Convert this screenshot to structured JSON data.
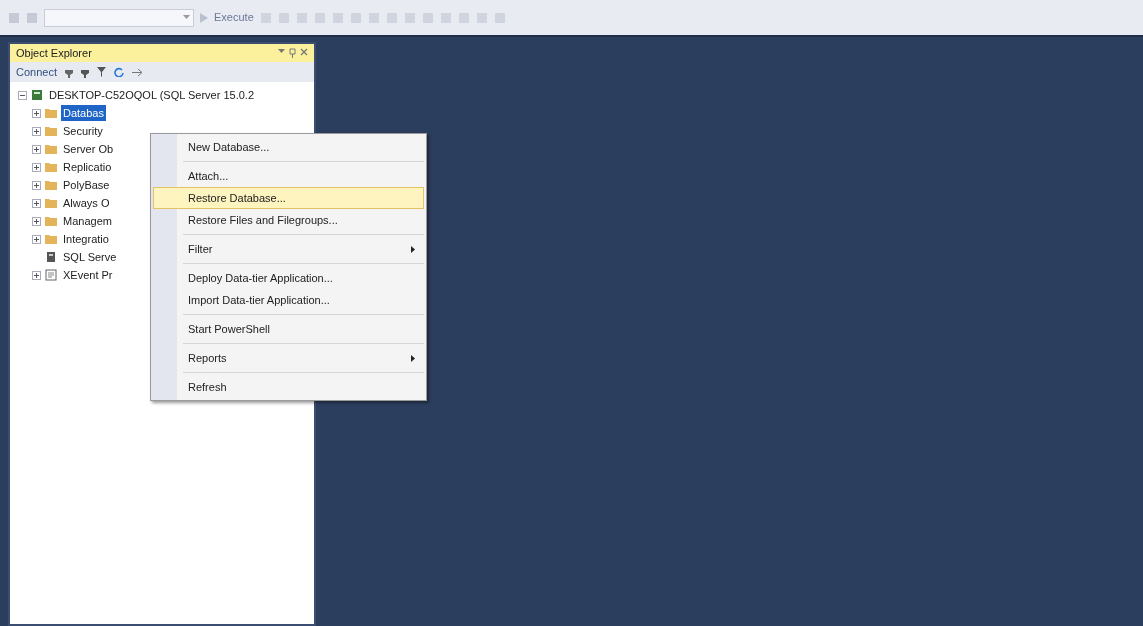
{
  "toolbar": {
    "execute_label": "Execute"
  },
  "object_explorer": {
    "title": "Object Explorer",
    "connect_label": "Connect",
    "tree": [
      {
        "label": "DESKTOP-C52OQOL (SQL Server 15.0.2",
        "kind": "server",
        "expanded": true,
        "selected": false,
        "children": [
          {
            "label": "Databas",
            "kind": "folder",
            "expanded": false,
            "selected": true
          },
          {
            "label": "Security",
            "kind": "folder",
            "expanded": false,
            "selected": false
          },
          {
            "label": "Server Ob",
            "kind": "folder",
            "expanded": false,
            "selected": false
          },
          {
            "label": "Replicatio",
            "kind": "folder",
            "expanded": false,
            "selected": false
          },
          {
            "label": "PolyBase",
            "kind": "folder",
            "expanded": false,
            "selected": false
          },
          {
            "label": "Always O",
            "kind": "folder",
            "expanded": false,
            "selected": false
          },
          {
            "label": "Managem",
            "kind": "folder",
            "expanded": false,
            "selected": false
          },
          {
            "label": "Integratio",
            "kind": "folder",
            "expanded": false,
            "selected": false
          },
          {
            "label": "SQL Serve",
            "kind": "agent",
            "selected": false
          },
          {
            "label": "XEvent Pr",
            "kind": "profiler",
            "expanded": false,
            "selected": false
          }
        ]
      }
    ]
  },
  "context_menu": [
    {
      "kind": "item",
      "label": "New Database...",
      "selected": false,
      "submenu": false
    },
    {
      "kind": "separator"
    },
    {
      "kind": "item",
      "label": "Attach...",
      "selected": false,
      "submenu": false
    },
    {
      "kind": "item",
      "label": "Restore Database...",
      "selected": true,
      "submenu": false
    },
    {
      "kind": "item",
      "label": "Restore Files and Filegroups...",
      "selected": false,
      "submenu": false
    },
    {
      "kind": "separator"
    },
    {
      "kind": "item",
      "label": "Filter",
      "selected": false,
      "submenu": true
    },
    {
      "kind": "separator"
    },
    {
      "kind": "item",
      "label": "Deploy Data-tier Application...",
      "selected": false,
      "submenu": false
    },
    {
      "kind": "item",
      "label": "Import Data-tier Application...",
      "selected": false,
      "submenu": false
    },
    {
      "kind": "separator"
    },
    {
      "kind": "item",
      "label": "Start PowerShell",
      "selected": false,
      "submenu": false
    },
    {
      "kind": "separator"
    },
    {
      "kind": "item",
      "label": "Reports",
      "selected": false,
      "submenu": true
    },
    {
      "kind": "separator"
    },
    {
      "kind": "item",
      "label": "Refresh",
      "selected": false,
      "submenu": false
    }
  ]
}
